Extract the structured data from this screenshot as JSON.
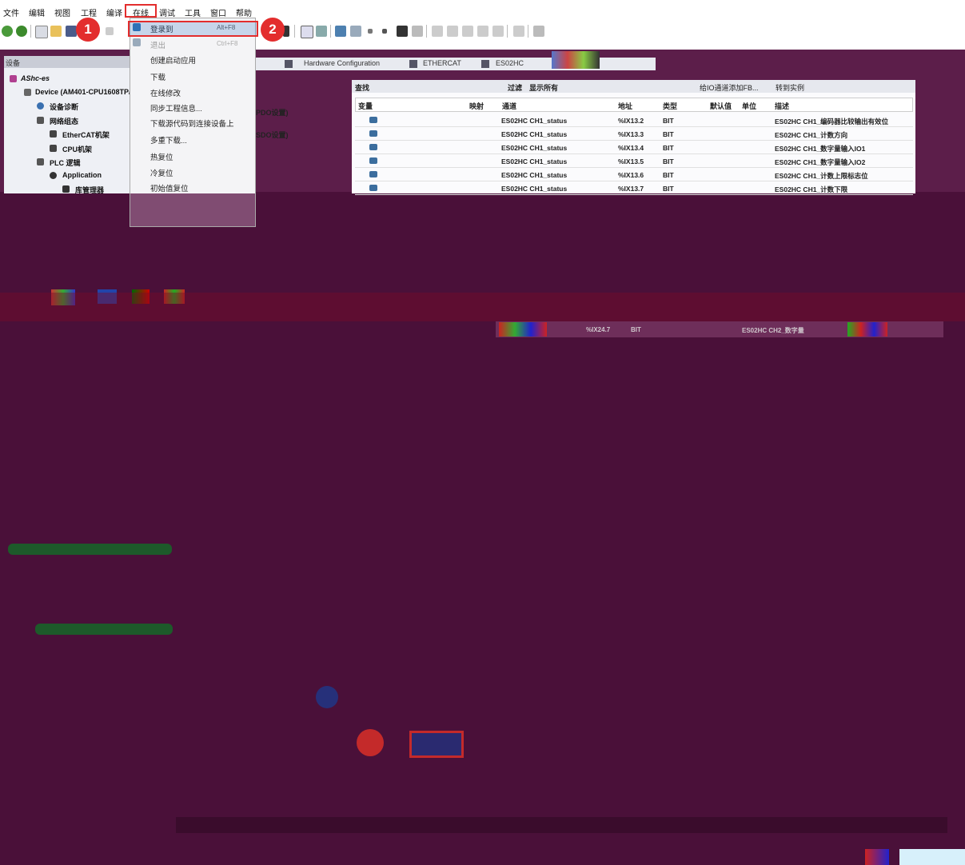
{
  "menubar": {
    "items": [
      "文件",
      "编辑",
      "视图",
      "工程",
      "编译",
      "在线",
      "调试",
      "工具",
      "窗口",
      "帮助"
    ]
  },
  "dropdown": {
    "items": [
      {
        "label": "登录到",
        "shortcut": "Alt+F8"
      },
      {
        "label": "退出",
        "shortcut": "Ctrl+F8"
      },
      {
        "label": "创建启动应用",
        "shortcut": ""
      },
      {
        "label": "下载",
        "shortcut": ""
      },
      {
        "label": "在线修改",
        "shortcut": ""
      },
      {
        "label": "同步工程信息...",
        "shortcut": ""
      },
      {
        "label": "下载源代码到连接设备上",
        "shortcut": ""
      },
      {
        "label": "多重下载...",
        "shortcut": ""
      },
      {
        "label": "热复位",
        "shortcut": ""
      },
      {
        "label": "冷复位",
        "shortcut": ""
      },
      {
        "label": "初始值复位",
        "shortcut": ""
      }
    ]
  },
  "badges": {
    "step1": "1",
    "step2": "2"
  },
  "tree": {
    "header": "设备",
    "items": [
      {
        "label": "AShc-es"
      },
      {
        "label": "Device (AM401-CPU1608TP/"
      },
      {
        "label": "设备诊断"
      },
      {
        "label": "网络组态"
      },
      {
        "label": "EtherCAT机架"
      },
      {
        "label": "CPU机架"
      },
      {
        "label": "PLC 逻辑"
      },
      {
        "label": "Application"
      },
      {
        "label": "库管理器"
      }
    ]
  },
  "tabs": {
    "items": [
      "Hardware Configuration",
      "ETHERCAT",
      "ES02HC"
    ]
  },
  "pdo": {
    "pdo_label": "PDO设置)",
    "sdo_label": "SDO设置)"
  },
  "io": {
    "find_label": "查找",
    "filter_label": "过滤",
    "filter_value": "显示所有",
    "add_fb_label": "给IO通道添加FB...",
    "goto_instance_label": "转到实例",
    "columns": [
      "变量",
      "映射",
      "通道",
      "地址",
      "类型",
      "默认值",
      "单位",
      "描述"
    ],
    "rows": [
      {
        "channel": "ES02HC CH1_status",
        "address": "%IX13.2",
        "type": "BIT",
        "desc": "ES02HC CH1_编码器比较输出有效位"
      },
      {
        "channel": "ES02HC CH1_status",
        "address": "%IX13.3",
        "type": "BIT",
        "desc": "ES02HC CH1_计数方向"
      },
      {
        "channel": "ES02HC CH1_status",
        "address": "%IX13.4",
        "type": "BIT",
        "desc": "ES02HC CH1_数字量输入IO1"
      },
      {
        "channel": "ES02HC CH1_status",
        "address": "%IX13.5",
        "type": "BIT",
        "desc": "ES02HC CH1_数字量输入IO2"
      },
      {
        "channel": "ES02HC CH1_status",
        "address": "%IX13.6",
        "type": "BIT",
        "desc": "ES02HC CH1_计数上限标志位"
      },
      {
        "channel": "ES02HC CH1_status",
        "address": "%IX13.7",
        "type": "BIT",
        "desc": "ES02HC CH1_计数下限"
      }
    ]
  },
  "glitch": {
    "addr": "%IX24.7",
    "type": "BIT",
    "desc": "ES02HC CH2_数字量"
  },
  "colors": {
    "accent_red": "#e32d2d",
    "overlay": "#5c1e4a"
  }
}
